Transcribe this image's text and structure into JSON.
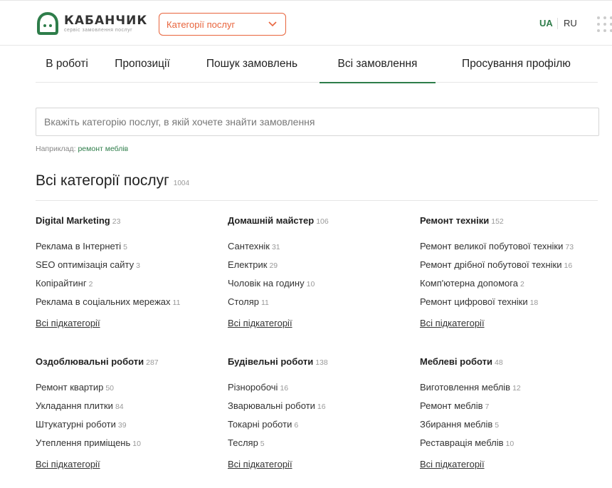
{
  "header": {
    "logo_name": "КАБАНЧИК",
    "logo_tagline": "сервіс замовлення послуг",
    "category_select_label": "Категорії послуг",
    "lang_ua": "UA",
    "lang_ru": "RU",
    "brand_color": "#2e7d4a",
    "accent_color": "#e8643c"
  },
  "tabs": [
    {
      "label": "В роботі"
    },
    {
      "label": "Пропозиції"
    },
    {
      "label": "Пошук замовлень"
    },
    {
      "label": "Всі замовлення",
      "active": true
    },
    {
      "label": "Просування профілю"
    }
  ],
  "search": {
    "placeholder": "Вкажіть категорію послуг, в якій хочете знайти замовлення",
    "example_prefix": "Наприклад:",
    "example_link": "ремонт меблів"
  },
  "section": {
    "title": "Всі категорії послуг",
    "count": "1004"
  },
  "all_subcategories_label": "Всі підкатегорії",
  "groups": [
    {
      "title": "Digital Marketing",
      "count": "23",
      "items": [
        {
          "label": "Реклама в Інтернеті",
          "count": "5"
        },
        {
          "label": "SEO оптимізація сайту",
          "count": "3"
        },
        {
          "label": "Копірайтинг",
          "count": "2"
        },
        {
          "label": "Реклама в соціальних мережах",
          "count": "11"
        }
      ]
    },
    {
      "title": "Домашній майстер",
      "count": "106",
      "items": [
        {
          "label": "Сантехнік",
          "count": "31"
        },
        {
          "label": "Електрик",
          "count": "29"
        },
        {
          "label": "Чоловік на годину",
          "count": "10"
        },
        {
          "label": "Столяр",
          "count": "11"
        }
      ]
    },
    {
      "title": "Ремонт техніки",
      "count": "152",
      "items": [
        {
          "label": "Ремонт великої побутової техніки",
          "count": "73"
        },
        {
          "label": "Ремонт дрібної побутової техніки",
          "count": "16"
        },
        {
          "label": "Комп'ютерна допомога",
          "count": "2"
        },
        {
          "label": "Ремонт цифрової техніки",
          "count": "18"
        }
      ]
    },
    {
      "title": "Оздоблювальні роботи",
      "count": "287",
      "items": [
        {
          "label": "Ремонт квартир",
          "count": "50"
        },
        {
          "label": "Укладання плитки",
          "count": "84"
        },
        {
          "label": "Штукатурні роботи",
          "count": "39"
        },
        {
          "label": "Утеплення приміщень",
          "count": "10"
        }
      ]
    },
    {
      "title": "Будівельні роботи",
      "count": "138",
      "items": [
        {
          "label": "Різноробочі",
          "count": "16"
        },
        {
          "label": "Зварювальні роботи",
          "count": "16"
        },
        {
          "label": "Токарні роботи",
          "count": "6"
        },
        {
          "label": "Тесляр",
          "count": "5"
        }
      ]
    },
    {
      "title": "Меблеві роботи",
      "count": "48",
      "items": [
        {
          "label": "Виготовлення меблів",
          "count": "12"
        },
        {
          "label": "Ремонт меблів",
          "count": "7"
        },
        {
          "label": "Збирання меблів",
          "count": "5"
        },
        {
          "label": "Реставрація меблів",
          "count": "10"
        }
      ]
    }
  ]
}
